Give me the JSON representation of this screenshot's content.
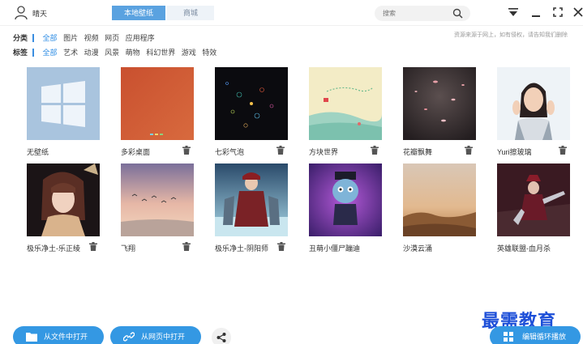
{
  "user": {
    "name": "晴天"
  },
  "tabs": [
    {
      "label": "本地壁纸",
      "active": true
    },
    {
      "label": "商城",
      "active": false
    }
  ],
  "search": {
    "placeholder": "搜索",
    "value": ""
  },
  "window_controls": [
    "dropdown-icon",
    "minimize-icon",
    "fullscreen-icon",
    "close-icon"
  ],
  "filters": {
    "class_label": "分类",
    "class_options": [
      "全部",
      "图片",
      "视频",
      "网页",
      "应用程序"
    ],
    "tag_label": "标签",
    "tag_options": [
      "全部",
      "艺术",
      "动漫",
      "风景",
      "萌物",
      "科幻世界",
      "游戏",
      "特效"
    ],
    "active_color": "#2f8de4"
  },
  "notice": "资源来源于网上，如有侵权，请告知我们删除",
  "wallpapers": [
    {
      "title": "无壁纸",
      "deletable": false
    },
    {
      "title": "多彩桌面",
      "deletable": true
    },
    {
      "title": "七彩气泡",
      "deletable": true
    },
    {
      "title": "方块世界",
      "deletable": true
    },
    {
      "title": "花瓣飘舞",
      "deletable": true
    },
    {
      "title": "Yuri擦玻璃",
      "deletable": true
    },
    {
      "title": "极乐净土-乐正绫",
      "deletable": true
    },
    {
      "title": "飞翔",
      "deletable": true
    },
    {
      "title": "极乐净土-阴阳师",
      "deletable": true
    },
    {
      "title": "丑萌小僵尸蹦迪",
      "deletable": false
    },
    {
      "title": "沙漠云涌",
      "deletable": false
    },
    {
      "title": "英雄联盟-血月杀",
      "deletable": false
    }
  ],
  "bottom": {
    "open_file": "从文件中打开",
    "open_web": "从网页中打开",
    "loop_play": "编辑循环播放"
  },
  "watermark": "最需教育",
  "colors": {
    "accent": "#3498e3",
    "tab_active": "#5aa2e0"
  }
}
